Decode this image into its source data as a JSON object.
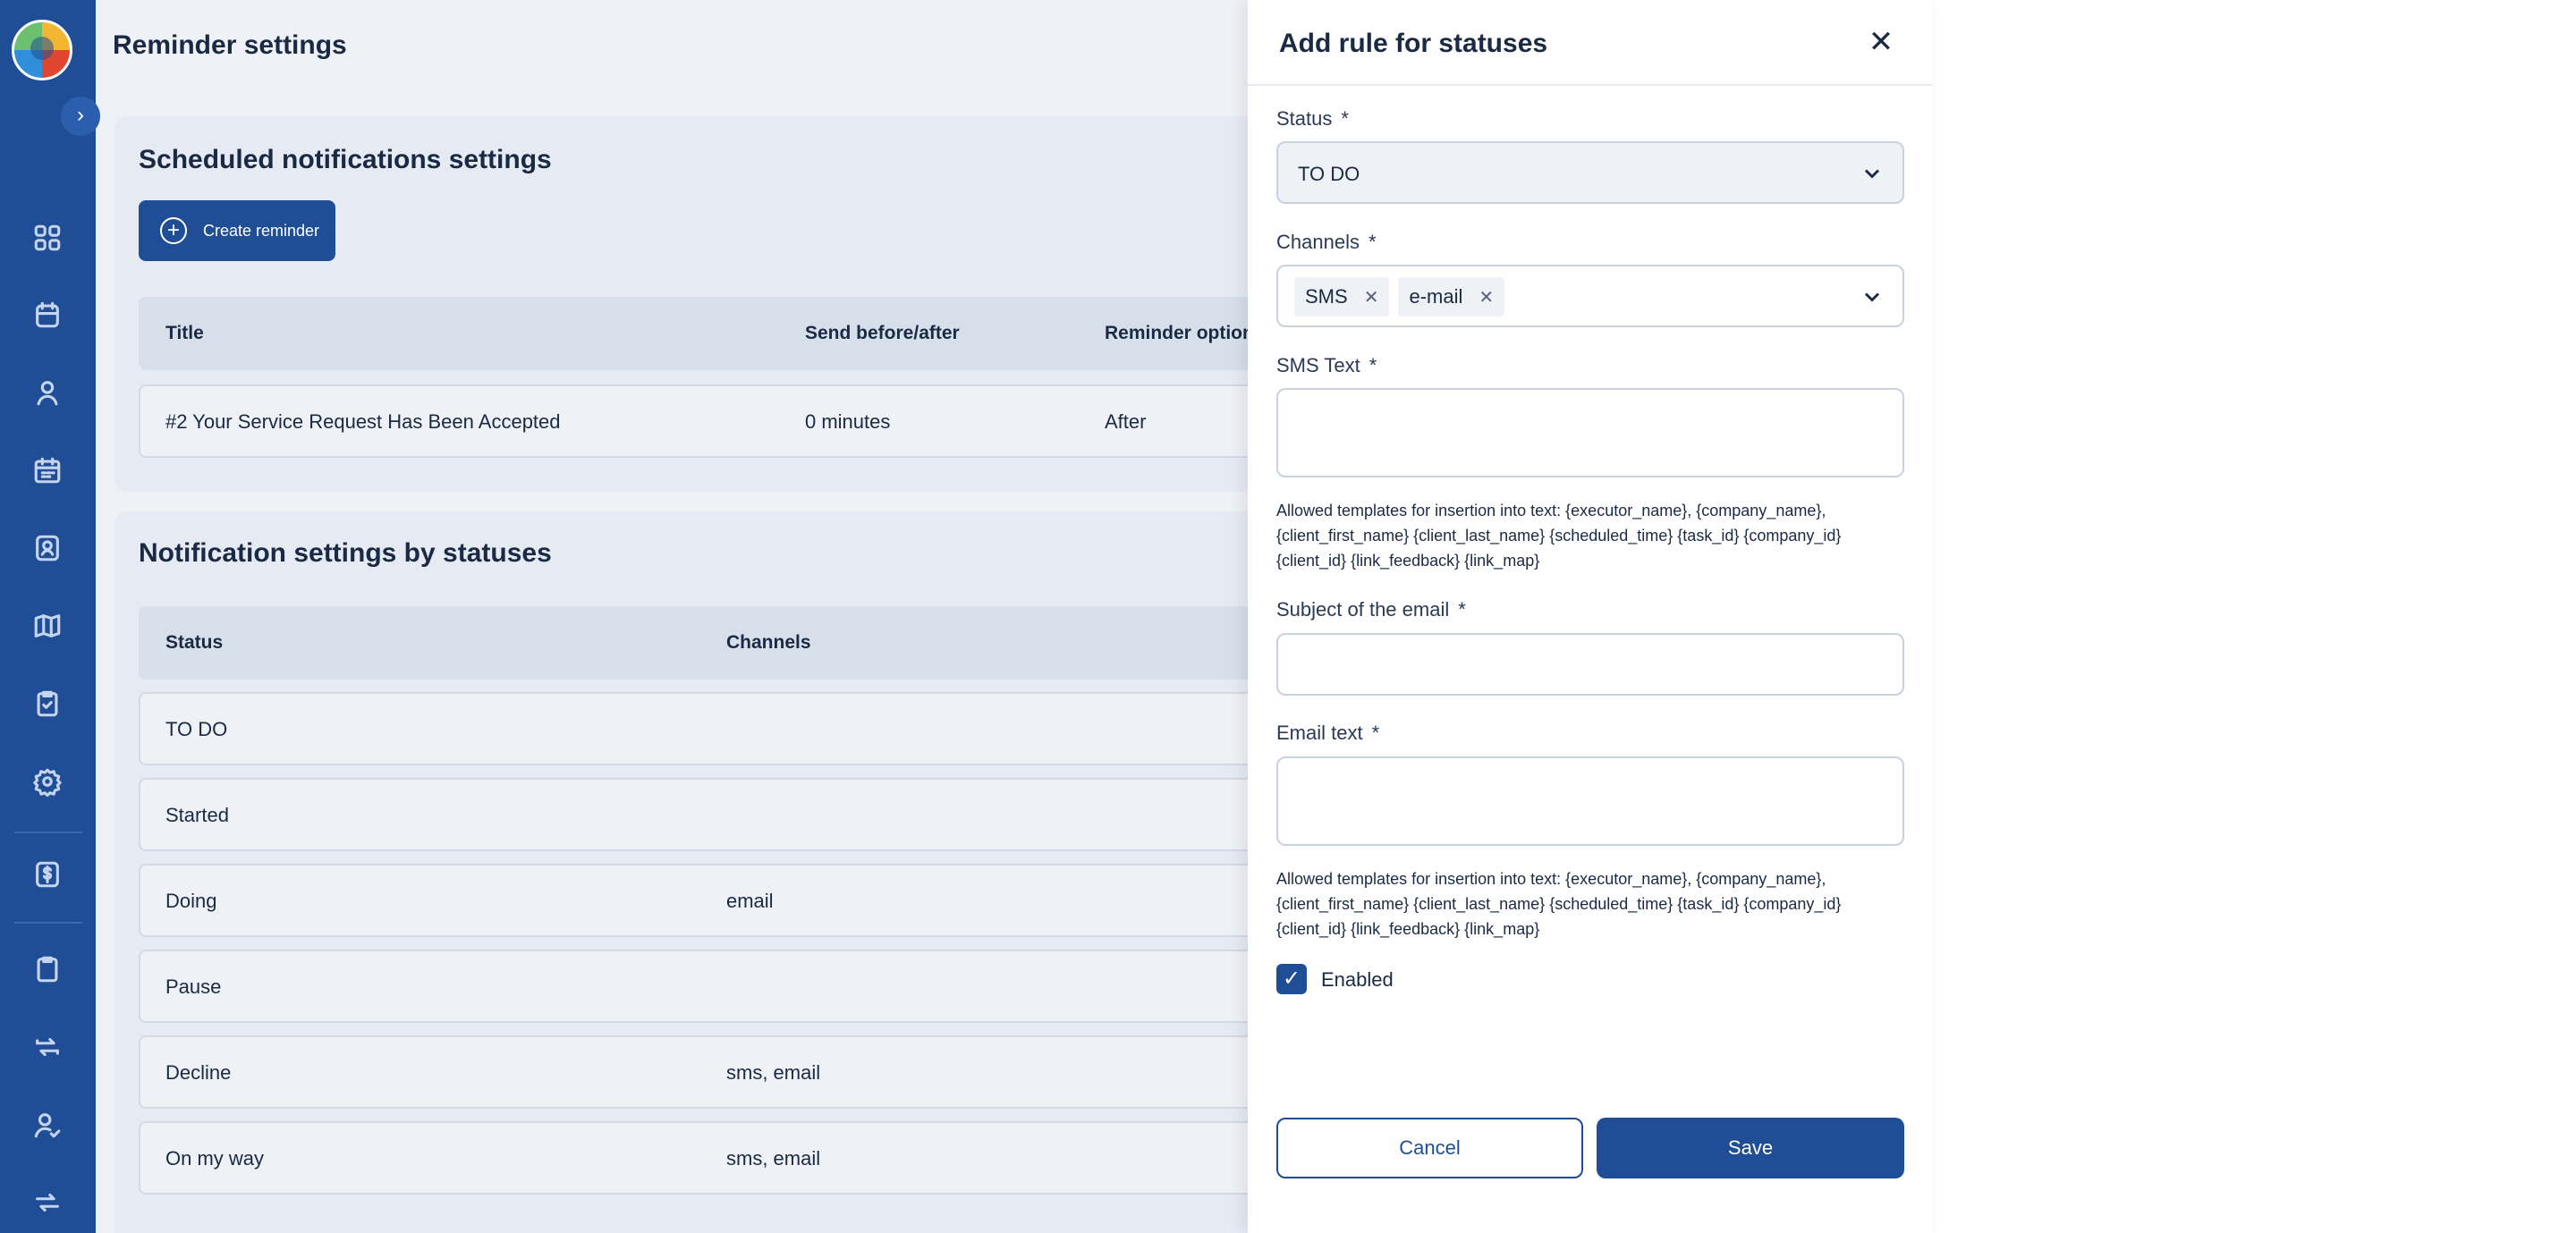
{
  "page": {
    "title": "Reminder settings"
  },
  "sidebar": {
    "collapse_icon": "chevron-right-icon",
    "items": [
      {
        "icon": "dashboard-icon"
      },
      {
        "icon": "tasks-icon"
      },
      {
        "icon": "user-icon"
      },
      {
        "icon": "calendar-icon"
      },
      {
        "icon": "contacts-icon"
      },
      {
        "icon": "map-icon"
      },
      {
        "icon": "clipboard-check-icon"
      },
      {
        "icon": "settings-icon"
      },
      {
        "icon": "dollar-icon"
      },
      {
        "icon": "clipboard-icon"
      },
      {
        "icon": "sync-icon"
      },
      {
        "icon": "user-check-icon"
      },
      {
        "icon": "repeat-icon"
      }
    ]
  },
  "scheduled": {
    "title": "Scheduled notifications settings",
    "create_label": "Create reminder",
    "columns": [
      "Title",
      "Send before/after",
      "Reminder option"
    ],
    "rows": [
      {
        "title": "#2 Your Service Request Has Been Accepted",
        "send": "0 minutes",
        "option": "After"
      }
    ]
  },
  "statuses": {
    "title": "Notification settings by statuses",
    "columns": [
      "Status",
      "Channels"
    ],
    "rows": [
      {
        "status": "TO DO",
        "channels": ""
      },
      {
        "status": "Started",
        "channels": ""
      },
      {
        "status": "Doing",
        "channels": "email"
      },
      {
        "status": "Pause",
        "channels": ""
      },
      {
        "status": "Decline",
        "channels": "sms, email"
      },
      {
        "status": "On my way",
        "channels": "sms, email"
      }
    ]
  },
  "drawer": {
    "title": "Add rule for statuses",
    "status_label": "Status",
    "status_value": "TO DO",
    "channels_label": "Channels",
    "channels": [
      "SMS",
      "e-mail"
    ],
    "sms_text_label": "SMS Text",
    "sms_hint": "Allowed templates for insertion into text: {executor_name}, {company_name}, {client_first_name} {client_last_name} {scheduled_time} {task_id} {company_id} {client_id} {link_feedback} {link_map}",
    "subject_label": "Subject of the email",
    "email_text_label": "Email text",
    "email_hint": "Allowed templates for insertion into text: {executor_name}, {company_name}, {client_first_name} {client_last_name} {scheduled_time} {task_id} {company_id} {client_id} {link_feedback} {link_map}",
    "enabled_label": "Enabled",
    "enabled": true,
    "required_mark": "*",
    "cancel_label": "Cancel",
    "save_label": "Save"
  },
  "colors": {
    "primary": "#1f4d96",
    "background": "#eef1f6"
  }
}
